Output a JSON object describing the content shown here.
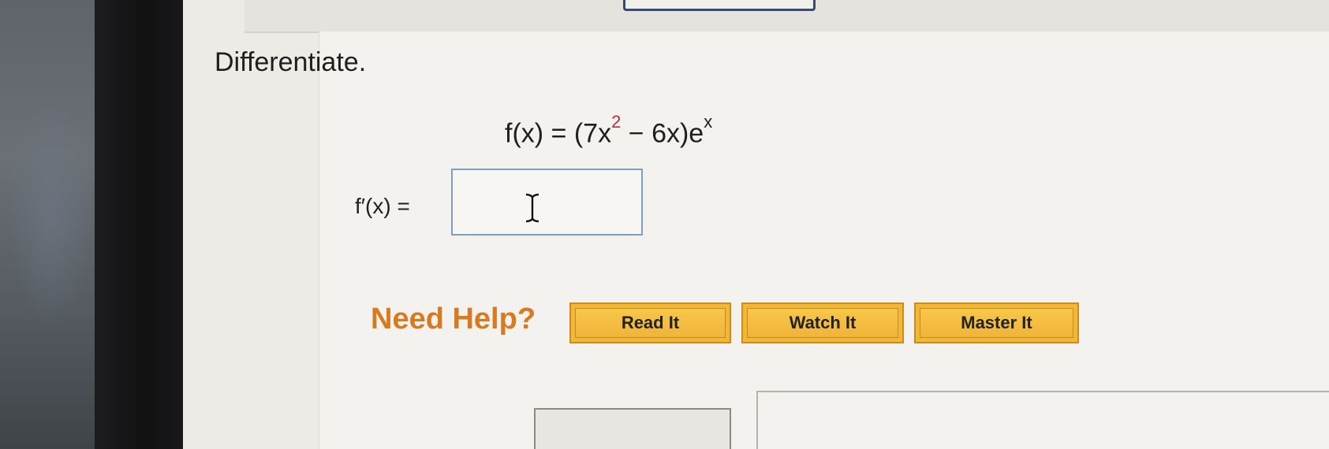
{
  "question": {
    "instruction": "Differentiate.",
    "function": {
      "lhs": "f(x) = ",
      "open": "(7x",
      "exponent": "2",
      "middle": " − 6x)e",
      "exp_var": "x"
    },
    "answer_label": "f′(x)  =",
    "answer_value": ""
  },
  "help": {
    "title": "Need Help?",
    "buttons": {
      "read": "Read It",
      "watch": "Watch It",
      "master": "Master It"
    }
  },
  "colors": {
    "accent_orange": "#d77a21",
    "button_fill": "#f1b838",
    "answer_border": "#7d9fc4",
    "exponent_red": "#b0323a"
  },
  "icons": {
    "text_cursor": "i-beam-cursor-icon"
  }
}
